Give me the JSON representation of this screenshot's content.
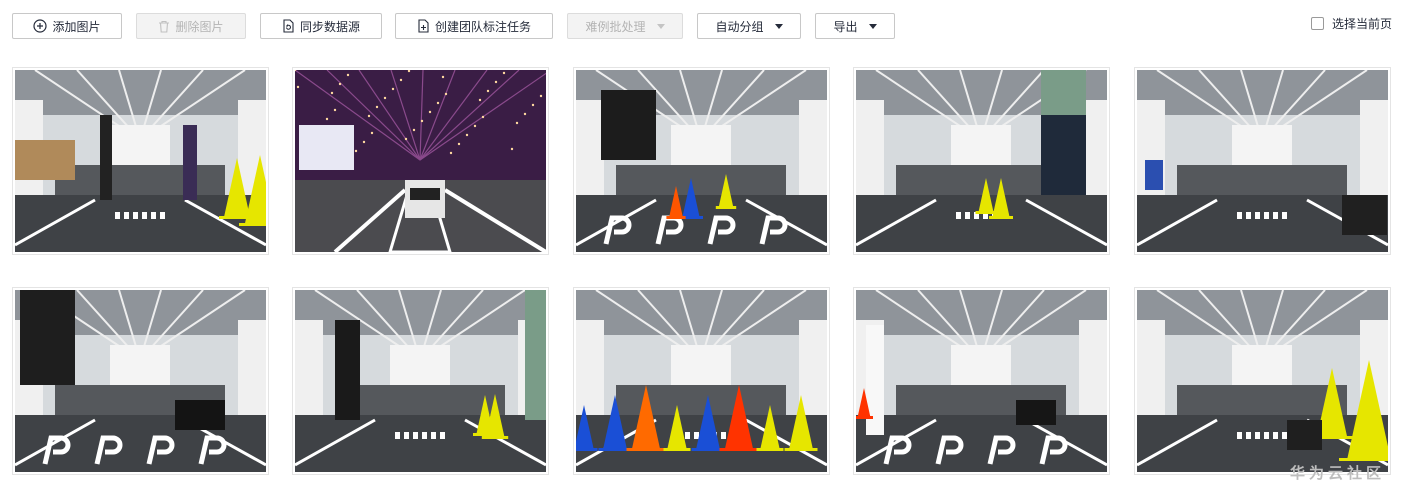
{
  "toolbar": {
    "add_image": "添加图片",
    "delete_image": "删除图片",
    "sync_datasource": "同步数据源",
    "create_team_task": "创建团队标注任务",
    "hard_example": "难例批处理",
    "auto_group": "自动分组",
    "export": "导出",
    "select_page": "选择当前页"
  },
  "watermark": "华为云社区",
  "images": [
    {
      "scene": "lab-cones",
      "theme": "lab"
    },
    {
      "scene": "hall-car",
      "theme": "hall"
    },
    {
      "scene": "p-marks-corridor",
      "theme": "lab"
    },
    {
      "scene": "person-legs",
      "theme": "lab"
    },
    {
      "scene": "parking-lab",
      "theme": "lab"
    },
    {
      "scene": "p-marks-left",
      "theme": "lab"
    },
    {
      "scene": "runner",
      "theme": "lab"
    },
    {
      "scene": "cone-corridor",
      "theme": "lab"
    },
    {
      "scene": "p-marks-table",
      "theme": "lab"
    },
    {
      "scene": "cones-right",
      "theme": "lab"
    }
  ]
}
